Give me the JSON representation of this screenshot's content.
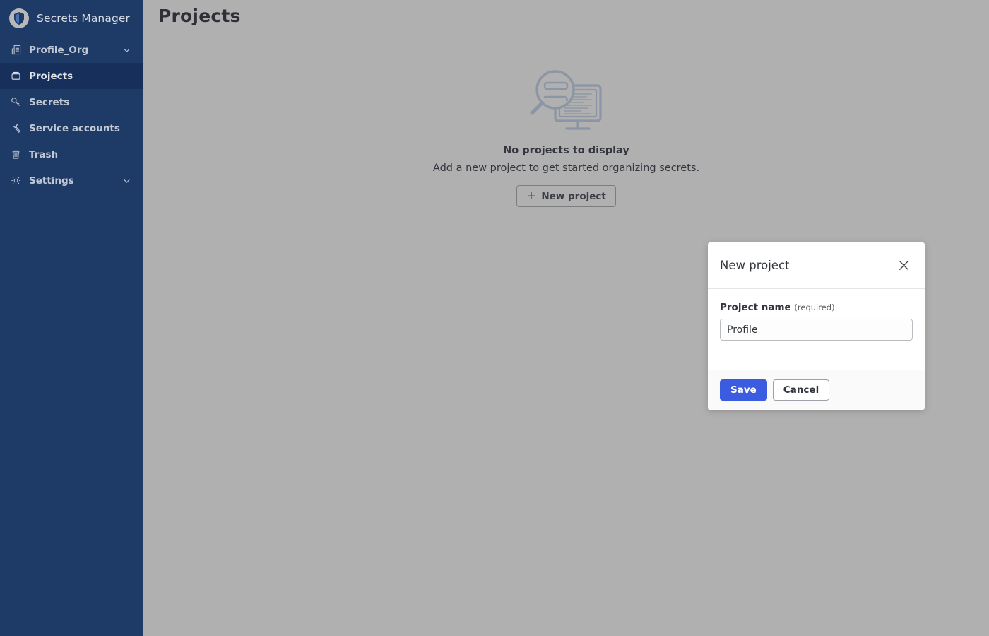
{
  "sidebar": {
    "brand": {
      "name": "Secrets Manager",
      "logo_icon": "shield-icon"
    },
    "items": [
      {
        "label": "Profile_Org",
        "icon": "building-icon",
        "chevron": "chevron-down-icon",
        "active": false
      },
      {
        "label": "Projects",
        "icon": "collection-icon",
        "active": true
      },
      {
        "label": "Secrets",
        "icon": "key-icon",
        "active": false
      },
      {
        "label": "Service accounts",
        "icon": "wrench-icon",
        "active": false
      },
      {
        "label": "Trash",
        "icon": "trash-icon",
        "active": false
      },
      {
        "label": "Settings",
        "icon": "gear-icon",
        "chevron": "chevron-down-icon",
        "active": false
      }
    ]
  },
  "header": {
    "title": "Projects"
  },
  "empty_state": {
    "illustration_icon": "magnifier-monitor-icon",
    "title": "No projects to display",
    "subtitle": "Add a new project to get started organizing secrets.",
    "button_label": "New project",
    "button_plus": "+"
  },
  "dialog": {
    "title": "New project",
    "close_icon": "close-icon",
    "field": {
      "label": "Project name",
      "required_note": "(required)",
      "value": "Profile",
      "placeholder": ""
    },
    "save_label": "Save",
    "cancel_label": "Cancel"
  },
  "colors": {
    "sidebar_navy": "#1e3a66",
    "sidebar_active": "#16305b",
    "overlay_grey": "#b0b0b0",
    "primary_blue": "#3b5ce0",
    "illustration_grey": "#8b95a3"
  }
}
